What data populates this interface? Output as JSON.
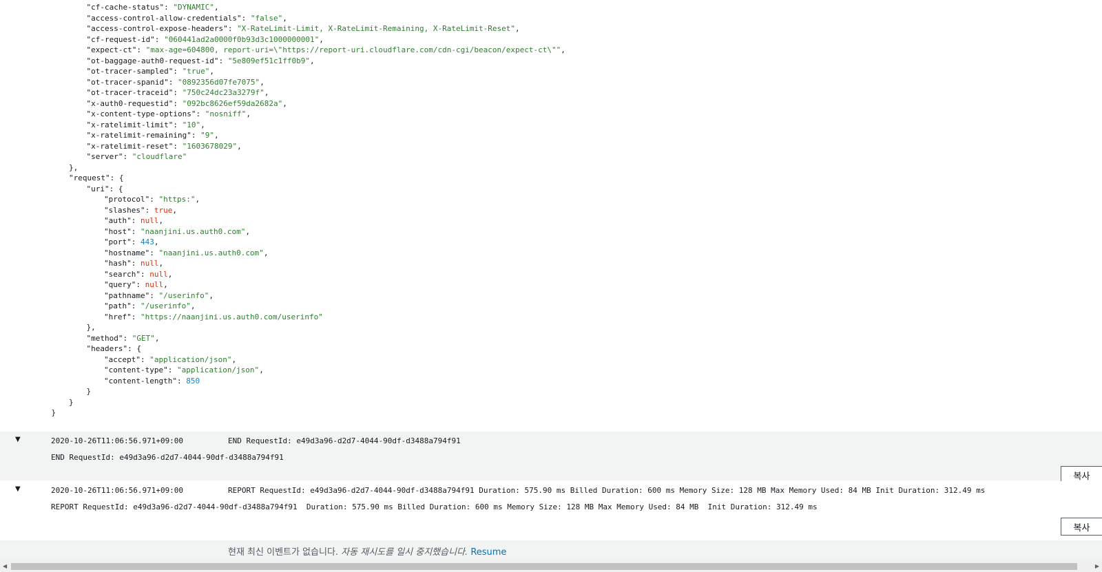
{
  "log_json_lines": [
    {
      "indent": 3,
      "key": "cf-cache-status",
      "value": "DYNAMIC",
      "type": "string",
      "comma": true
    },
    {
      "indent": 3,
      "key": "access-control-allow-credentials",
      "value": "false",
      "type": "string",
      "comma": true
    },
    {
      "indent": 3,
      "key": "access-control-expose-headers",
      "value": "X-RateLimit-Limit, X-RateLimit-Remaining, X-RateLimit-Reset",
      "type": "string",
      "comma": true
    },
    {
      "indent": 3,
      "key": "cf-request-id",
      "value": "060441ad2a0000f0b93d3c1000000001",
      "type": "string",
      "comma": true
    },
    {
      "indent": 3,
      "key": "expect-ct",
      "value": "max-age=604800, report-uri=\\\"https://report-uri.cloudflare.com/cdn-cgi/beacon/expect-ct\\\"",
      "type": "string",
      "comma": true
    },
    {
      "indent": 3,
      "key": "ot-baggage-auth0-request-id",
      "value": "5e809ef51c1ff0b9",
      "type": "string",
      "comma": true
    },
    {
      "indent": 3,
      "key": "ot-tracer-sampled",
      "value": "true",
      "type": "string",
      "comma": true
    },
    {
      "indent": 3,
      "key": "ot-tracer-spanid",
      "value": "0892356d07fe7075",
      "type": "string",
      "comma": true
    },
    {
      "indent": 3,
      "key": "ot-tracer-traceid",
      "value": "750c24dc23a3279f",
      "type": "string",
      "comma": true
    },
    {
      "indent": 3,
      "key": "x-auth0-requestid",
      "value": "092bc8626ef59da2682a",
      "type": "string",
      "comma": true
    },
    {
      "indent": 3,
      "key": "x-content-type-options",
      "value": "nosniff",
      "type": "string",
      "comma": true
    },
    {
      "indent": 3,
      "key": "x-ratelimit-limit",
      "value": "10",
      "type": "string",
      "comma": true
    },
    {
      "indent": 3,
      "key": "x-ratelimit-remaining",
      "value": "9",
      "type": "string",
      "comma": true
    },
    {
      "indent": 3,
      "key": "x-ratelimit-reset",
      "value": "1603678029",
      "type": "string",
      "comma": true
    },
    {
      "indent": 3,
      "key": "server",
      "value": "cloudflare",
      "type": "string",
      "comma": false
    },
    {
      "indent": 2,
      "punct": "},"
    },
    {
      "indent": 2,
      "key": "request",
      "punct": "{"
    },
    {
      "indent": 3,
      "key": "uri",
      "punct": "{"
    },
    {
      "indent": 4,
      "key": "protocol",
      "value": "https:",
      "type": "string",
      "comma": true
    },
    {
      "indent": 4,
      "key": "slashes",
      "value": "true",
      "type": "bool",
      "comma": true
    },
    {
      "indent": 4,
      "key": "auth",
      "value": "null",
      "type": "null",
      "comma": true
    },
    {
      "indent": 4,
      "key": "host",
      "value": "naanjini.us.auth0.com",
      "type": "string",
      "comma": true
    },
    {
      "indent": 4,
      "key": "port",
      "value": "443",
      "type": "number",
      "comma": true
    },
    {
      "indent": 4,
      "key": "hostname",
      "value": "naanjini.us.auth0.com",
      "type": "string",
      "comma": true
    },
    {
      "indent": 4,
      "key": "hash",
      "value": "null",
      "type": "null",
      "comma": true
    },
    {
      "indent": 4,
      "key": "search",
      "value": "null",
      "type": "null",
      "comma": true
    },
    {
      "indent": 4,
      "key": "query",
      "value": "null",
      "type": "null",
      "comma": true
    },
    {
      "indent": 4,
      "key": "pathname",
      "value": "/userinfo",
      "type": "string",
      "comma": true
    },
    {
      "indent": 4,
      "key": "path",
      "value": "/userinfo",
      "type": "string",
      "comma": true
    },
    {
      "indent": 4,
      "key": "href",
      "value": "https://naanjini.us.auth0.com/userinfo",
      "type": "string",
      "comma": false
    },
    {
      "indent": 3,
      "punct": "},"
    },
    {
      "indent": 3,
      "key": "method",
      "value": "GET",
      "type": "string",
      "comma": true
    },
    {
      "indent": 3,
      "key": "headers",
      "punct": "{"
    },
    {
      "indent": 4,
      "key": "accept",
      "value": "application/json",
      "type": "string",
      "comma": true
    },
    {
      "indent": 4,
      "key": "content-type",
      "value": "application/json",
      "type": "string",
      "comma": true
    },
    {
      "indent": 4,
      "key": "content-length",
      "value": "850",
      "type": "number",
      "comma": false
    },
    {
      "indent": 3,
      "punct": "}"
    },
    {
      "indent": 2,
      "punct": "}"
    },
    {
      "indent": 1,
      "punct": "}"
    }
  ],
  "events": [
    {
      "timestamp": "2020-10-26T11:06:56.971+09:00",
      "summary": "END RequestId: e49d3a96-d2d7-4044-90df-d3488a794f91",
      "detail": "END RequestId: e49d3a96-d2d7-4044-90df-d3488a794f91",
      "expand_glyph": "▼",
      "copy_label": "복사"
    },
    {
      "timestamp": "2020-10-26T11:06:56.971+09:00",
      "summary": "REPORT RequestId: e49d3a96-d2d7-4044-90df-d3488a794f91 Duration: 575.90 ms Billed Duration: 600 ms Memory Size: 128 MB Max Memory Used: 84 MB Init Duration: 312.49 ms",
      "detail": "REPORT RequestId: e49d3a96-d2d7-4044-90df-d3488a794f91\tDuration: 575.90 ms\tBilled Duration: 600 ms\tMemory Size: 128 MB\tMax Memory Used: 84 MB\tInit Duration: 312.49 ms",
      "expand_glyph": "▼",
      "copy_label": "복사"
    }
  ],
  "status": {
    "message": "현재 최신 이벤트가 없습니다. ",
    "auto_retry_text": "자동 재시도를 일시 중지했습니다.",
    "resume_label": "Resume"
  },
  "scrollbar": {
    "left_arrow": "◀",
    "right_arrow": "▶"
  }
}
